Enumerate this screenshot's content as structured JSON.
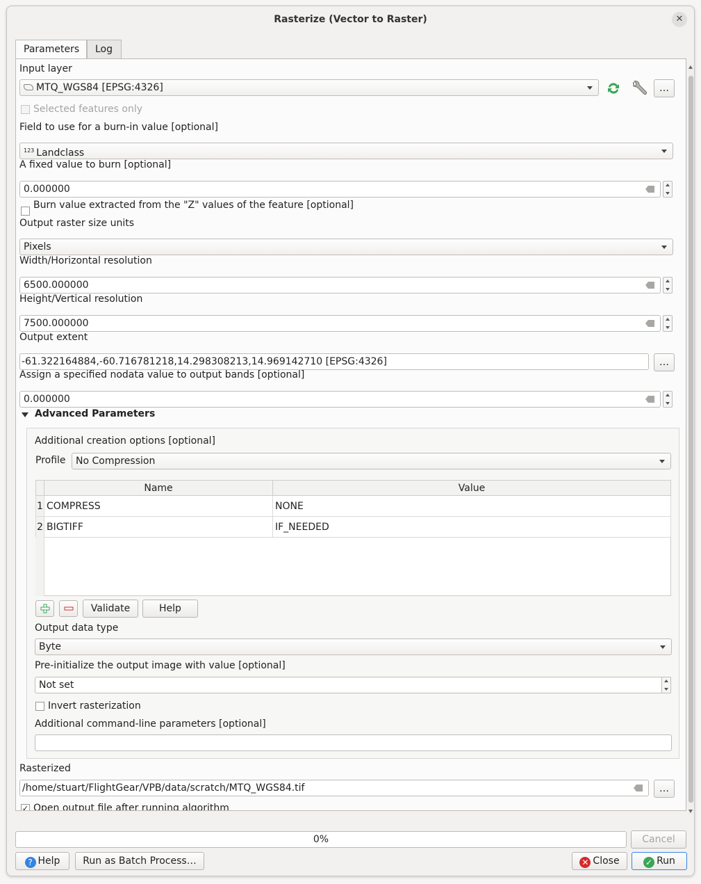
{
  "window": {
    "title": "Rasterize (Vector to Raster)"
  },
  "tabs": [
    "Parameters",
    "Log"
  ],
  "input_layer": {
    "label": "Input layer",
    "value": "MTQ_WGS84 [EPSG:4326]",
    "more": "…",
    "selected_only": "Selected features only"
  },
  "burn_field": {
    "label": "Field to use for a burn-in value [optional]",
    "type_badge": "123",
    "value": "Landclass"
  },
  "fixed_value": {
    "label": "A fixed value to burn [optional]",
    "value": "0.000000"
  },
  "burn_z": {
    "label": "Burn value extracted from the \"Z\" values of the feature [optional]"
  },
  "size_units": {
    "label": "Output raster size units",
    "value": "Pixels"
  },
  "width": {
    "label": "Width/Horizontal resolution",
    "value": "6500.000000"
  },
  "height": {
    "label": "Height/Vertical resolution",
    "value": "7500.000000"
  },
  "extent": {
    "label": "Output extent",
    "value": "-61.322164884,-60.716781218,14.298308213,14.969142710 [EPSG:4326]",
    "more": "…"
  },
  "nodata": {
    "label": "Assign a specified nodata value to output bands [optional]",
    "value": "0.000000"
  },
  "advanced": {
    "header": "Advanced Parameters",
    "creation_label": "Additional creation options [optional]",
    "profile_label": "Profile",
    "profile_value": "No Compression",
    "table_headers": [
      "Name",
      "Value"
    ],
    "rows": [
      {
        "num": "1",
        "name": "COMPRESS",
        "value": "NONE"
      },
      {
        "num": "2",
        "name": "BIGTIFF",
        "value": "IF_NEEDED"
      }
    ],
    "validate": "Validate",
    "help": "Help",
    "data_type_label": "Output data type",
    "data_type_value": "Byte",
    "init_label": "Pre-initialize the output image with value [optional]",
    "init_value": "Not set",
    "invert_label": "Invert rasterization",
    "cmd_label": "Additional command-line parameters [optional]",
    "cmd_value": ""
  },
  "rasterized": {
    "label": "Rasterized",
    "value": "/home/stuart/FlightGear/VPB/data/scratch/MTQ_WGS84.tif",
    "more": "…",
    "open_after": "Open output file after running algorithm"
  },
  "progress": {
    "text": "0%",
    "value": 0,
    "cancel": "Cancel"
  },
  "footer": {
    "help": "Help",
    "batch": "Run as Batch Process…",
    "close": "Close",
    "run": "Run"
  },
  "colors": {
    "accent_green": "#3aa655",
    "close_red": "#d52b2b",
    "help_blue": "#3584e4"
  }
}
